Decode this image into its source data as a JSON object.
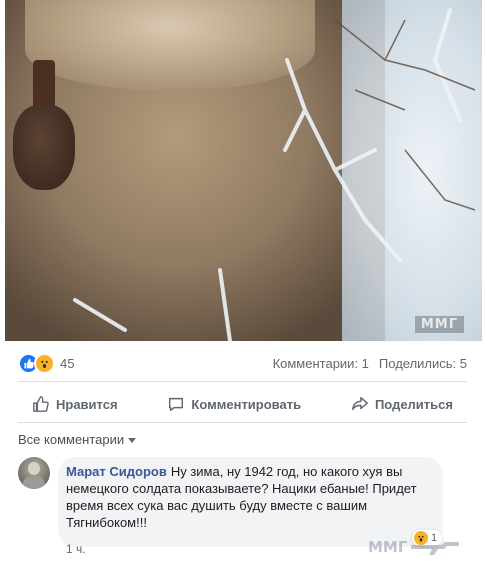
{
  "post": {
    "watermark_photo": "ММГ"
  },
  "summary": {
    "reaction_count": "45",
    "comments": "Комментарии: 1",
    "shares": "Поделились: 5"
  },
  "actions": {
    "like": "Нравится",
    "comment": "Комментировать",
    "share": "Поделиться"
  },
  "comments_filter": "Все комментарии",
  "comment": {
    "author": "Марат Сидоров",
    "text": "Ну зима, ну 1942 год, но какого хуя вы немецкого солдата показываете? Нацики ебаные! Придет время всех сука вас душить буду вместе с вашим Тягнибоком!!!",
    "time": "1 ч.",
    "reaction_count": "1"
  },
  "watermark_corner": "ММГ",
  "colors": {
    "accent": "#385898",
    "like_blue": "#1877f2",
    "wow_yellow": "#f7b125"
  }
}
